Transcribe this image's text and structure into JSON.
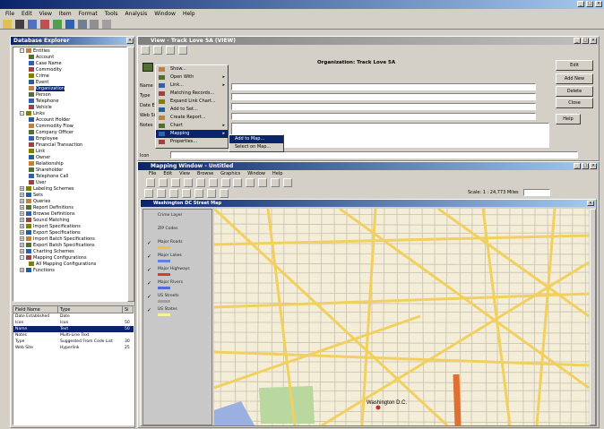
{
  "app": {
    "title": "",
    "menu": [
      "File",
      "Edit",
      "View",
      "Item",
      "Format",
      "Tools",
      "Analysis",
      "Window",
      "Help"
    ]
  },
  "explorer": {
    "title": "Database Explorer",
    "tree": [
      {
        "label": "Entities",
        "indent": 1,
        "expander": "-"
      },
      {
        "label": "Account",
        "indent": 3
      },
      {
        "label": "Case Name",
        "indent": 3
      },
      {
        "label": "Commodity",
        "indent": 3
      },
      {
        "label": "Crime",
        "indent": 3
      },
      {
        "label": "Event",
        "indent": 3
      },
      {
        "label": "Organization",
        "indent": 3,
        "selected": true
      },
      {
        "label": "Person",
        "indent": 3
      },
      {
        "label": "Telephone",
        "indent": 3
      },
      {
        "label": "Vehicle",
        "indent": 3
      },
      {
        "label": "Links",
        "indent": 1,
        "expander": "-"
      },
      {
        "label": "Account Holder",
        "indent": 3
      },
      {
        "label": "Commodity Flow",
        "indent": 3
      },
      {
        "label": "Company Officer",
        "indent": 3
      },
      {
        "label": "Employee",
        "indent": 3
      },
      {
        "label": "Financial Transaction",
        "indent": 3
      },
      {
        "label": "Link",
        "indent": 3
      },
      {
        "label": "Owner",
        "indent": 3
      },
      {
        "label": "Relationship",
        "indent": 3
      },
      {
        "label": "Shareholder",
        "indent": 3
      },
      {
        "label": "Telephone Call",
        "indent": 3
      },
      {
        "label": "User",
        "indent": 3
      },
      {
        "label": "Labeling Schemes",
        "indent": 1,
        "expander": "+"
      },
      {
        "label": "Sets",
        "indent": 1,
        "expander": "+"
      },
      {
        "label": "Queries",
        "indent": 1,
        "expander": "+"
      },
      {
        "label": "Report Definitions",
        "indent": 1,
        "expander": "+"
      },
      {
        "label": "Browse Definitions",
        "indent": 1,
        "expander": "+"
      },
      {
        "label": "Sound Matching",
        "indent": 1,
        "expander": "+"
      },
      {
        "label": "Import Specifications",
        "indent": 1,
        "expander": "+"
      },
      {
        "label": "Export Specifications",
        "indent": 1,
        "expander": "+"
      },
      {
        "label": "Import Batch Specifications",
        "indent": 1,
        "expander": "+"
      },
      {
        "label": "Export Batch Specifications",
        "indent": 1,
        "expander": "+"
      },
      {
        "label": "Charting Schemes",
        "indent": 1,
        "expander": "+"
      },
      {
        "label": "Mapping Configurations",
        "indent": 1,
        "expander": "-"
      },
      {
        "label": "All Mapping Configurations",
        "indent": 3
      },
      {
        "label": "Functions",
        "indent": 1,
        "expander": "+"
      }
    ],
    "props_headers": [
      "Field Name",
      "Type",
      "Si"
    ],
    "props_rows": [
      {
        "name": "Date Established",
        "type": "Date",
        "size": ""
      },
      {
        "name": "Icon",
        "type": "Icon",
        "size": "50"
      },
      {
        "name": "Name",
        "type": "Text",
        "size": "50",
        "selected": true
      },
      {
        "name": "Notes",
        "type": "Multi-Line Text",
        "size": ""
      },
      {
        "name": "Type",
        "type": "Suggested From Code List",
        "size": "30"
      },
      {
        "name": "Web Site",
        "type": "Hyperlink",
        "size": "25"
      }
    ]
  },
  "record": {
    "title": "View - Track Love 5A (VIEW)",
    "heading": "Organization: Track Love 5A",
    "field_labels": [
      "Name",
      "Type",
      "Date Est.",
      "Web Site",
      "Notes"
    ],
    "icon_label": "Icon",
    "buttons": [
      "Edit",
      "Add New",
      "Delete",
      "Close",
      "Help"
    ]
  },
  "context_menu": {
    "items": [
      {
        "label": "Show...",
        "arrow": ""
      },
      {
        "label": "Open With",
        "arrow": "▸"
      },
      {
        "label": "Link...",
        "arrow": "▸"
      },
      {
        "label": "Matching Records...",
        "arrow": ""
      },
      {
        "label": "Expand Link Chart...",
        "arrow": ""
      },
      {
        "label": "Add to Set...",
        "arrow": ""
      },
      {
        "label": "Create Report...",
        "arrow": ""
      },
      {
        "label": "Chart",
        "arrow": "▸"
      },
      {
        "label": "Mapping",
        "arrow": "▸",
        "selected": true
      },
      {
        "label": "Properties...",
        "arrow": ""
      }
    ],
    "submenu": [
      {
        "label": "Add to Map...",
        "selected": true
      },
      {
        "label": "Select on Map..."
      }
    ]
  },
  "map": {
    "window_title": "Mapping Window - Untitled",
    "menu": [
      "File",
      "Edit",
      "View",
      "Browse",
      "Graphics",
      "Window",
      "Help"
    ],
    "inner_title": "Washington DC Street Map",
    "scale_label": "Scale: 1 : 24,773 Miles",
    "layers": [
      {
        "label": "Crime Layer",
        "checked": false,
        "color": ""
      },
      {
        "label": "ZIP Codes",
        "checked": false,
        "color": ""
      },
      {
        "label": "Major Roads",
        "checked": true,
        "color": "#f0c040"
      },
      {
        "label": "Major Lakes",
        "checked": true,
        "color": "#6080e0"
      },
      {
        "label": "Major Highways",
        "checked": true,
        "color": "#d04030"
      },
      {
        "label": "Major Rivers",
        "checked": true,
        "color": "#5070d0"
      },
      {
        "label": "US Streets",
        "checked": true,
        "color": "#a0a0a0"
      },
      {
        "label": "US States",
        "checked": true,
        "color": "#f8f0a0"
      }
    ],
    "place_label": "Washington D.C.",
    "road_color": "#f2d060",
    "highway_color": "#e07030",
    "park_color": "#b8d8a0",
    "water_color": "#9ab0e0"
  }
}
